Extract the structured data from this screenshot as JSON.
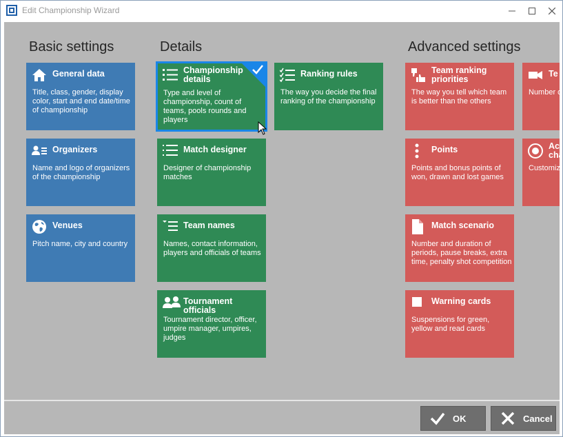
{
  "window": {
    "title": "Edit Championship Wizard"
  },
  "columns": {
    "basic": "Basic settings",
    "details": "Details",
    "advanced": "Advanced settings"
  },
  "tiles": {
    "general_data": {
      "title": "General data",
      "desc": "Title, class, gender, display color, start and end date/time of championship",
      "icon": "home-icon"
    },
    "organizers": {
      "title": "Organizers",
      "desc": "Name and logo of organizers of the championship",
      "icon": "person-list-icon"
    },
    "venues": {
      "title": "Venues",
      "desc": "Pitch name, city and country",
      "icon": "globe-icon"
    },
    "championship_details": {
      "title": "Championship details",
      "desc": "Type and level of championship, count of teams, pools rounds and players",
      "icon": "list-icon"
    },
    "ranking_rules": {
      "title": "Ranking rules",
      "desc": "The way you decide the final ranking of the championship",
      "icon": "checklist-icon"
    },
    "match_designer": {
      "title": "Match designer",
      "desc": "Designer of championship matches",
      "icon": "list-icon"
    },
    "team_names": {
      "title": "Team names",
      "desc": "Names, contact information, players and officials of teams",
      "icon": "sorted-list-icon"
    },
    "tournament_officials": {
      "title": "Tournament officials",
      "desc": "Tournament director, officer, umpire manager, umpires, judges",
      "icon": "people-icon"
    },
    "team_ranking_priorities": {
      "title": "Team ranking priorities",
      "desc": "The way you tell which team is better than the others",
      "icon": "thumbs-icon"
    },
    "points": {
      "title": "Points",
      "desc": "Points and bonus points of won, drawn and lost games",
      "icon": "dots-icon"
    },
    "match_scenario": {
      "title": "Match scenario",
      "desc": "Number and duration of periods, pause breaks, extra time, penalty shot competition",
      "icon": "document-icon"
    },
    "warning_cards": {
      "title": "Warning cards",
      "desc": "Suspensions for green, yellow and read cards",
      "icon": "card-icon"
    },
    "partial_1": {
      "title": "Te",
      "desc": "Number of umpire rec",
      "icon": "video-icon"
    },
    "partial_2": {
      "title": "Ac cha",
      "title_line1": "Ac",
      "title_line2": "cha",
      "desc": "Customize champion",
      "icon": "record-icon"
    }
  },
  "buttons": {
    "ok": "OK",
    "cancel": "Cancel"
  },
  "colors": {
    "blue": "#3f7bb4",
    "green": "#2f8a55",
    "red": "#d35b59",
    "selected": "#1a86e8"
  }
}
